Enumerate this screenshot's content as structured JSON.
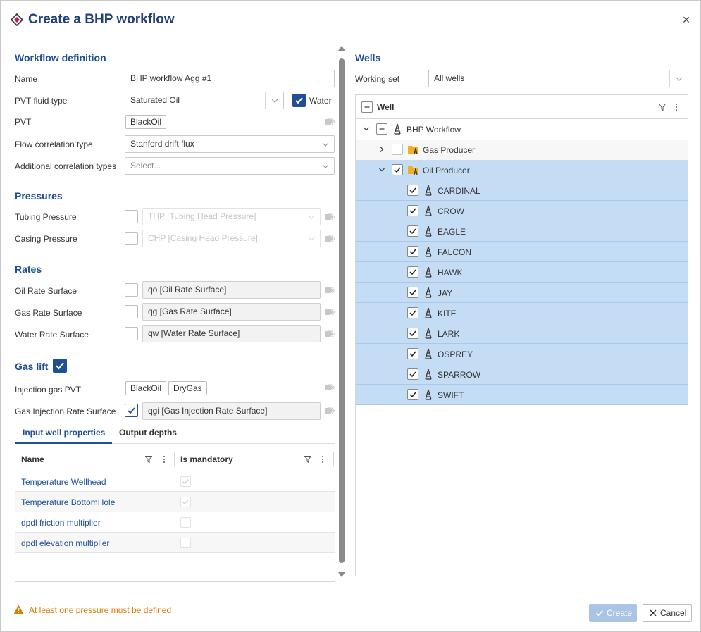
{
  "dialog": {
    "title": "Create a BHP workflow",
    "close_label": "×"
  },
  "definition": {
    "section_title": "Workflow definition",
    "name_label": "Name",
    "name_value": "BHP workflow Agg #1",
    "pvt_fluid_type_label": "PVT fluid type",
    "pvt_fluid_type_value": "Saturated Oil",
    "water_label": "Water",
    "water_checked": true,
    "pvt_label": "PVT",
    "pvt_chip": "BlackOil",
    "flow_correlation_label": "Flow correlation type",
    "flow_correlation_value": "Stanford drift flux",
    "additional_correlation_label": "Additional correlation types",
    "additional_correlation_placeholder": "Select..."
  },
  "pressures": {
    "section_title": "Pressures",
    "tubing_label": "Tubing Pressure",
    "tubing_value": "THP [Tubing Head Pressure]",
    "casing_label": "Casing Pressure",
    "casing_value": "CHP [Casing Head Pressure]"
  },
  "rates": {
    "section_title": "Rates",
    "oil_label": "Oil Rate Surface",
    "oil_value": "qo [Oil Rate Surface]",
    "gas_label": "Gas Rate Surface",
    "gas_value": "qg [Gas Rate Surface]",
    "water_label": "Water Rate Surface",
    "water_value": "qw [Water Rate Surface]"
  },
  "gas_lift": {
    "section_title": "Gas lift",
    "enabled": true,
    "injection_pvt_label": "Injection gas PVT",
    "injection_pvt_chips": [
      "BlackOil",
      "DryGas"
    ],
    "injection_rate_label": "Gas Injection Rate Surface",
    "injection_rate_value": "qgi [Gas Injection Rate Surface]"
  },
  "tabs": [
    "Input well properties",
    "Output depths"
  ],
  "properties_grid": {
    "col_name": "Name",
    "col_mandatory": "Is mandatory",
    "rows": [
      {
        "name": "Temperature Wellhead",
        "mandatory": true
      },
      {
        "name": "Temperature BottomHole",
        "mandatory": true
      },
      {
        "name": "dpdl friction multiplier",
        "mandatory": false
      },
      {
        "name": "dpdl elevation multiplier",
        "mandatory": false
      }
    ]
  },
  "wells": {
    "section_title": "Wells",
    "working_set_label": "Working set",
    "working_set_value": "All wells",
    "tree_header": "Well",
    "root": "BHP Workflow",
    "groups": [
      {
        "name": "Gas Producer",
        "expanded": false,
        "checked": false
      },
      {
        "name": "Oil Producer",
        "expanded": true,
        "checked": true
      }
    ],
    "oil_wells": [
      "CARDINAL",
      "CROW",
      "EAGLE",
      "FALCON",
      "HAWK",
      "JAY",
      "KITE",
      "LARK",
      "OSPREY",
      "SPARROW",
      "SWIFT"
    ]
  },
  "footer": {
    "warning": "At least one pressure must be defined",
    "create_label": "Create",
    "cancel_label": "Cancel"
  },
  "colors": {
    "accent": "#1f4f96",
    "selection": "#c5dcf5",
    "warning": "#e07a00"
  }
}
